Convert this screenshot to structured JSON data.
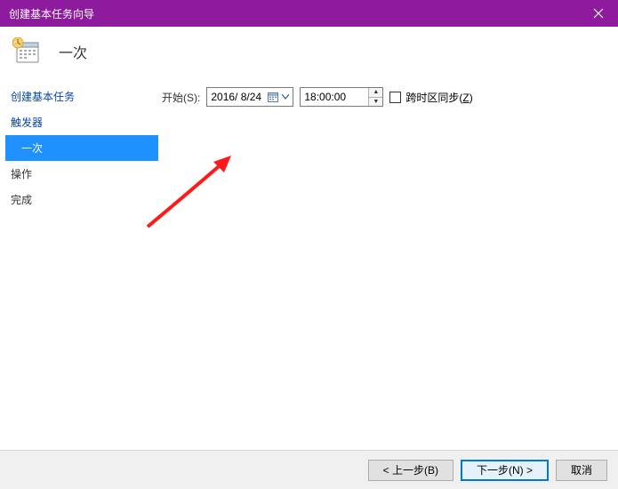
{
  "window": {
    "title": "创建基本任务向导"
  },
  "header": {
    "title": "一次"
  },
  "sidebar": {
    "items": [
      {
        "label": "创建基本任务",
        "selected": false,
        "link": true
      },
      {
        "label": "触发器",
        "selected": false,
        "link": true
      },
      {
        "label": "一次",
        "selected": true,
        "link": false
      },
      {
        "label": "操作",
        "selected": false,
        "link": false
      },
      {
        "label": "完成",
        "selected": false,
        "link": false
      }
    ]
  },
  "form": {
    "start_label": "开始(S):",
    "date_value": "2016/ 8/24",
    "time_value": "18:00:00",
    "sync_across_tz_label": "跨时区同步(Z)"
  },
  "footer": {
    "back_label": "< 上一步(B)",
    "next_label": "下一步(N) >",
    "cancel_label": "取消"
  }
}
